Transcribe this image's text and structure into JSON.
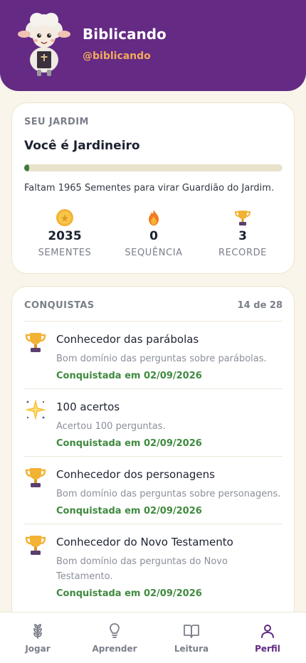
{
  "header": {
    "app_name": "Biblicando",
    "handle": "@biblicando",
    "avatar": "sheep-avatar-icon"
  },
  "garden": {
    "section_label": "SEU JARDIM",
    "title": "Você é Jardineiro",
    "progress_fraction": 0.015,
    "description": "Faltam 1965 Sementes para virar Guardião do Jardim.",
    "stats": [
      {
        "icon": "coin-icon",
        "value": "2035",
        "label": "SEMENTES"
      },
      {
        "icon": "flame-icon",
        "value": "0",
        "label": "SEQUÊNCIA"
      },
      {
        "icon": "trophy-icon",
        "value": "3",
        "label": "RECORDE"
      }
    ]
  },
  "achievements": {
    "section_label": "CONQUISTAS",
    "count": "14 de 28",
    "items": [
      {
        "icon": "trophy-icon",
        "title": "Conhecedor das parábolas",
        "desc": "Bom domínio das perguntas sobre parábolas.",
        "date": "Conquistada em 02/09/2026"
      },
      {
        "icon": "sparkle-icon",
        "title": "100 acertos",
        "desc": "Acertou 100 perguntas.",
        "date": "Conquistada em 02/09/2026"
      },
      {
        "icon": "trophy-icon",
        "title": "Conhecedor dos personagens",
        "desc": "Bom domínio das perguntas sobre personagens.",
        "date": "Conquistada em 02/09/2026"
      },
      {
        "icon": "trophy-icon",
        "title": "Conhecedor do Novo Testamento",
        "desc": "Bom domínio das perguntas do Novo Testamento.",
        "date": "Conquistada em 02/09/2026"
      }
    ]
  },
  "nav": {
    "items": [
      {
        "icon": "wheat-icon",
        "label": "Jogar"
      },
      {
        "icon": "lightbulb-icon",
        "label": "Aprender"
      },
      {
        "icon": "book-icon",
        "label": "Leitura"
      },
      {
        "icon": "user-icon",
        "label": "Perfil"
      }
    ],
    "active": "Perfil"
  },
  "colors": {
    "header_bg": "#642a84",
    "handle": "#f3a95e",
    "progress": "#3c7d3c",
    "achievement_date": "#3f8a3f",
    "nav_active": "#5f2a82"
  }
}
